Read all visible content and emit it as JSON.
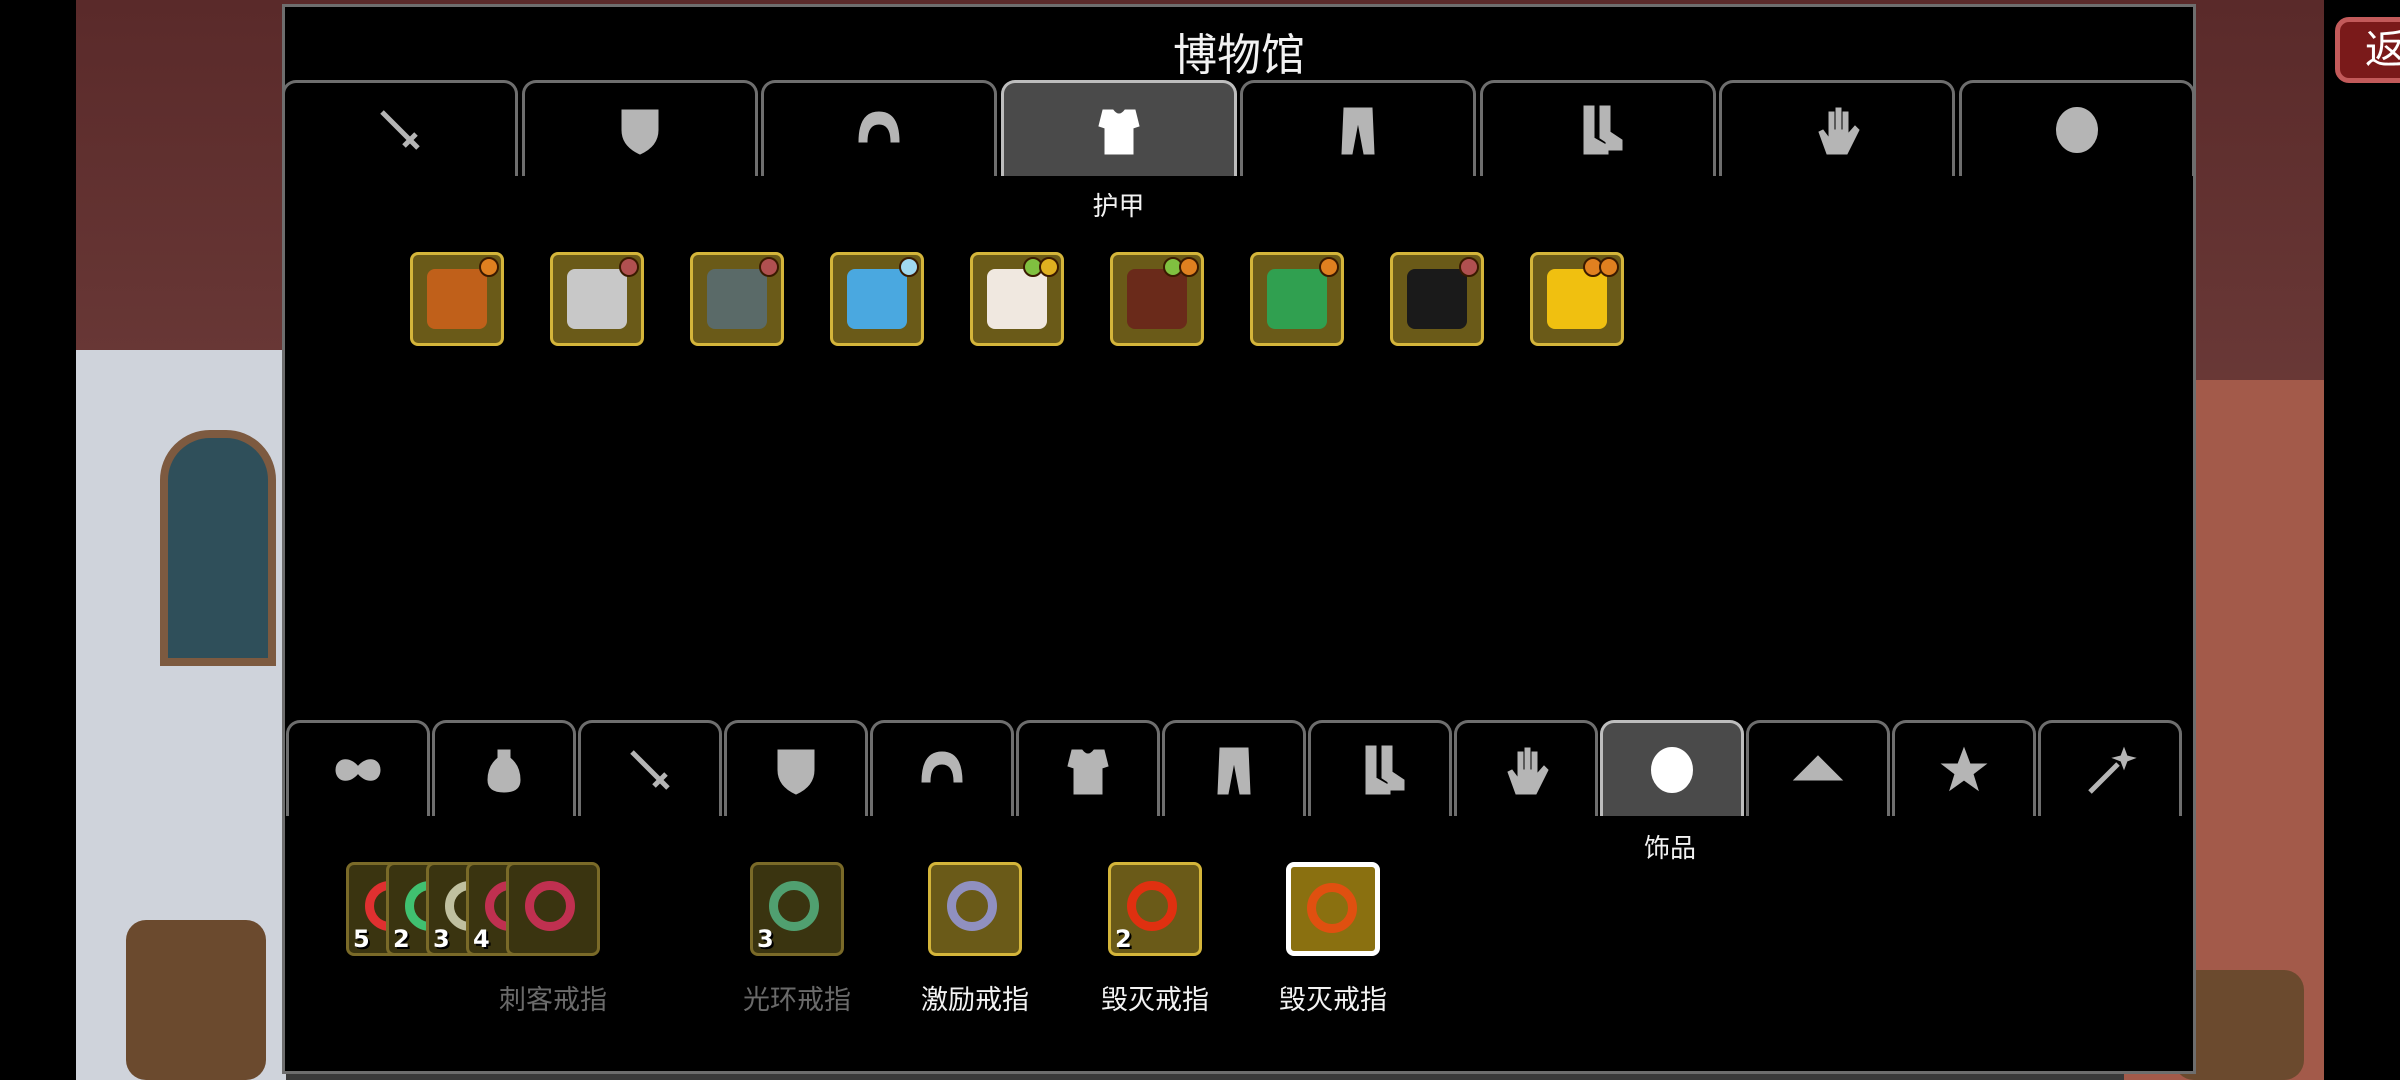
{
  "title": "博物馆",
  "back_label": "返回",
  "top_tabs": [
    {
      "icon": "sword-icon",
      "label": ""
    },
    {
      "icon": "shield-icon",
      "label": ""
    },
    {
      "icon": "helmet-icon",
      "label": ""
    },
    {
      "icon": "armor-icon",
      "label": "护甲",
      "active": true
    },
    {
      "icon": "pants-icon",
      "label": ""
    },
    {
      "icon": "boots-icon",
      "label": ""
    },
    {
      "icon": "glove-icon",
      "label": ""
    },
    {
      "icon": "ring-icon",
      "label": ""
    }
  ],
  "armor_items": [
    {
      "color": "#c0601a",
      "gems": [
        "#e08020"
      ]
    },
    {
      "color": "#c8c8c8",
      "gems": [
        "#b05050"
      ]
    },
    {
      "color": "#5a6a68",
      "gems": [
        "#b05050"
      ]
    },
    {
      "color": "#4aa8e0",
      "gems": [
        "#a0d8f0"
      ]
    },
    {
      "color": "#f0e8e0",
      "gems": [
        "#80c040",
        "#e0b020"
      ]
    },
    {
      "color": "#6a2a1a",
      "gems": [
        "#80c040",
        "#e08020"
      ]
    },
    {
      "color": "#30a050",
      "gems": [
        "#e08020"
      ]
    },
    {
      "color": "#1a1a1a",
      "gems": [
        "#b05050"
      ]
    },
    {
      "color": "#f0c010",
      "gems": [
        "#e08020",
        "#e08020"
      ]
    }
  ],
  "bottom_tabs": [
    {
      "icon": "infinity-icon",
      "label": ""
    },
    {
      "icon": "potion-icon",
      "label": ""
    },
    {
      "icon": "sword-icon",
      "label": ""
    },
    {
      "icon": "shield-icon",
      "label": ""
    },
    {
      "icon": "helmet-icon",
      "label": ""
    },
    {
      "icon": "armor-icon",
      "label": ""
    },
    {
      "icon": "pants-icon",
      "label": ""
    },
    {
      "icon": "boots-icon",
      "label": ""
    },
    {
      "icon": "glove-icon",
      "label": ""
    },
    {
      "icon": "ring-icon",
      "label": "饰品",
      "active": true
    },
    {
      "icon": "hat-icon",
      "label": ""
    },
    {
      "icon": "star-icon",
      "label": ""
    },
    {
      "icon": "wand-icon",
      "label": ""
    }
  ],
  "ring_groups": [
    {
      "name": "刺客戒指",
      "dim": true,
      "stack": [
        {
          "color": "#e03030",
          "count": "5"
        },
        {
          "color": "#40c070",
          "count": "2"
        },
        {
          "color": "#c0c0a0",
          "count": "3"
        },
        {
          "color": "#c03050",
          "count": "4"
        },
        {
          "color": "#c03050",
          "count": ""
        }
      ]
    },
    {
      "name": "光环戒指",
      "dim": true,
      "stack": [
        {
          "color": "#50a070",
          "count": "3"
        }
      ]
    },
    {
      "name": "激励戒指",
      "dim": false,
      "stack": [
        {
          "color": "#9090c0",
          "count": ""
        }
      ]
    },
    {
      "name": "毁灭戒指",
      "dim": false,
      "stack": [
        {
          "color": "#e03010",
          "count": "2"
        }
      ]
    },
    {
      "name": "毁灭戒指",
      "dim": false,
      "selected": true,
      "stack": [
        {
          "color": "#e05010",
          "count": ""
        }
      ]
    }
  ],
  "colors": {
    "label_dim": "#6a6a6a",
    "label_bright": "#f2f2f2",
    "accent_gold": "#d4b53a",
    "back_red": "#7a1a1a"
  }
}
